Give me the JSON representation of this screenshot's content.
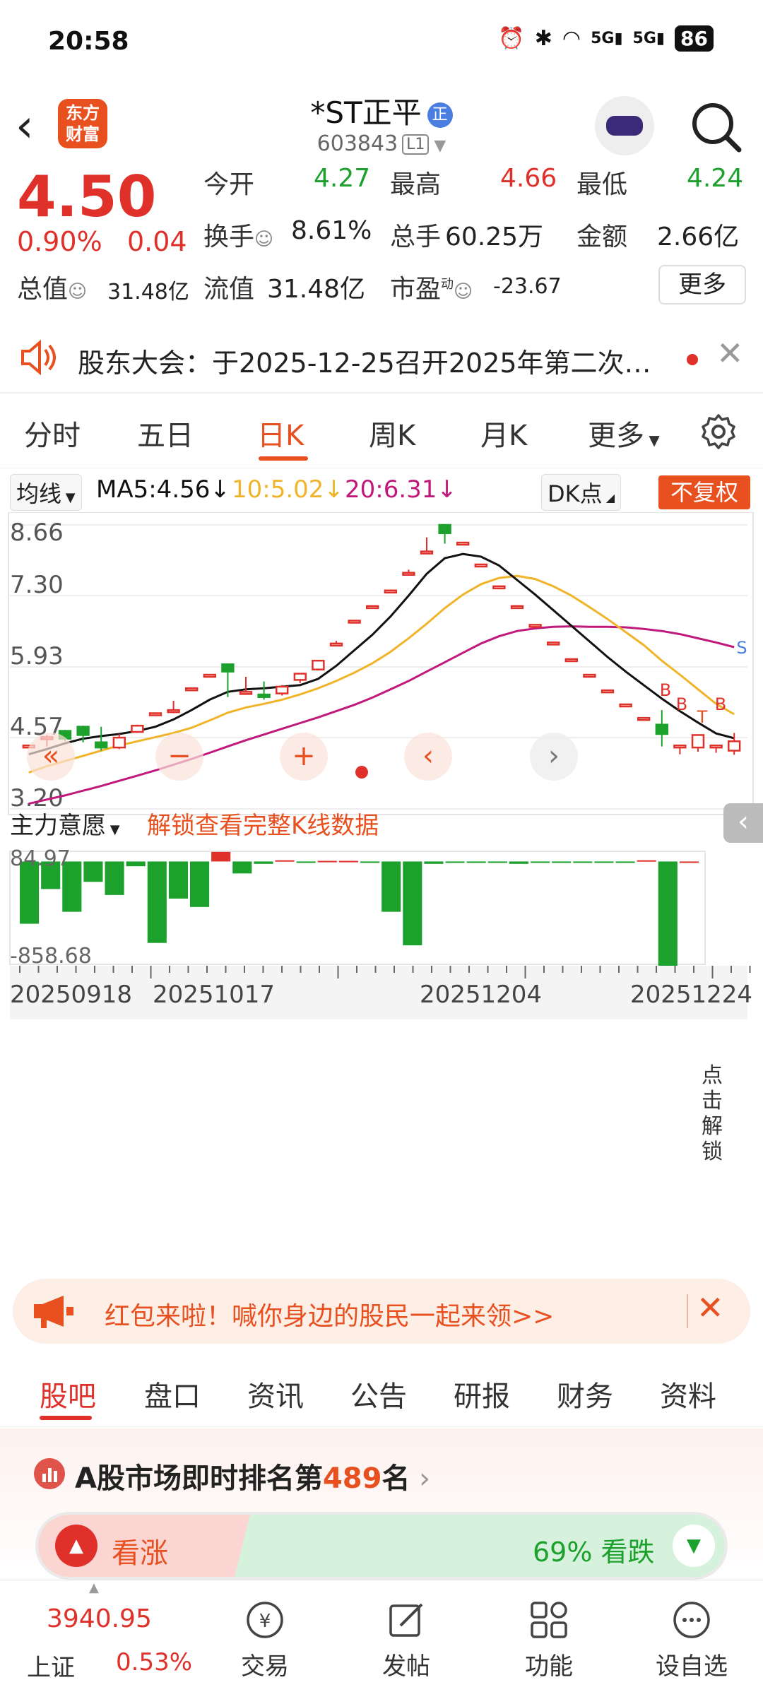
{
  "status_bar": {
    "time": "20:58",
    "battery": "86",
    "signal_1": "5G",
    "signal_2": "5G"
  },
  "header": {
    "logo_line1": "东方",
    "logo_line2": "财富",
    "title": "*ST正平",
    "title_badge": "正",
    "code": "603843",
    "level": "L1"
  },
  "quote": {
    "price": "4.50",
    "change_pct": "0.90%",
    "change_amt": "0.04",
    "open_label": "今开",
    "open": "4.27",
    "high_label": "最高",
    "high": "4.66",
    "low_label": "最低",
    "low": "4.24",
    "turnover_label": "换手",
    "turnover": "8.61%",
    "volume_label": "总手",
    "volume": "60.25万",
    "amount_label": "金额",
    "amount": "2.66亿",
    "total_mv_label": "总值",
    "total_mv": "31.48亿",
    "float_mv_label": "流值",
    "float_mv": "31.48亿",
    "pe_label": "市盈",
    "pe_sup": "动",
    "pe": "-23.67",
    "more": "更多"
  },
  "notice": {
    "text": "股东大会：于2025-12-25召开2025年第二次临..."
  },
  "kline_tabs": {
    "tabs": [
      "分时",
      "五日",
      "日K",
      "周K",
      "月K",
      "更多"
    ],
    "active": "日K"
  },
  "chart_controls": {
    "ma_selector": "均线",
    "ma5": "MA5:4.56",
    "ma10": "10:5.02",
    "ma20": "20:6.31",
    "dk": "DK点",
    "fq": "不复权",
    "indicator_selector": "主力意愿",
    "unlock_text": "解锁查看完整K线数据",
    "click_unlock": "点击解锁"
  },
  "colors": {
    "up": "#e0302a",
    "down": "#1da12d",
    "ma5": "#111111",
    "ma10": "#f0b429",
    "ma20": "#c0197b",
    "accent": "#e8501f"
  },
  "chart_data": {
    "type": "candlestick",
    "y_ticks": [
      "8.66",
      "7.30",
      "5.93",
      "4.57",
      "3.20"
    ],
    "ylim": [
      3.2,
      8.66
    ],
    "x_labels": [
      "20250918",
      "20251017",
      "20251204",
      "20251224"
    ],
    "candles": [
      {
        "o": 4.42,
        "c": 4.42,
        "h": 4.42,
        "l": 4.42
      },
      {
        "o": 4.55,
        "c": 4.58,
        "h": 4.62,
        "l": 4.4
      },
      {
        "o": 4.7,
        "c": 4.55,
        "h": 4.72,
        "l": 4.5
      },
      {
        "o": 4.78,
        "c": 4.62,
        "h": 4.8,
        "l": 4.48
      },
      {
        "o": 4.48,
        "c": 4.38,
        "h": 4.78,
        "l": 4.32
      },
      {
        "o": 4.38,
        "c": 4.57,
        "h": 4.64,
        "l": 4.35
      },
      {
        "o": 4.68,
        "c": 4.8,
        "h": 4.82,
        "l": 4.66
      },
      {
        "o": 5.04,
        "c": 5.04,
        "h": 5.04,
        "l": 5.04
      },
      {
        "o": 5.1,
        "c": 5.1,
        "h": 5.28,
        "l": 5.04
      },
      {
        "o": 5.52,
        "c": 5.52,
        "h": 5.52,
        "l": 5.52
      },
      {
        "o": 5.78,
        "c": 5.78,
        "h": 5.78,
        "l": 5.78
      },
      {
        "o": 5.98,
        "c": 5.84,
        "h": 5.98,
        "l": 5.35
      },
      {
        "o": 5.45,
        "c": 5.45,
        "h": 5.74,
        "l": 5.42
      },
      {
        "o": 5.4,
        "c": 5.35,
        "h": 5.65,
        "l": 5.3
      },
      {
        "o": 5.42,
        "c": 5.55,
        "h": 5.58,
        "l": 5.38
      },
      {
        "o": 5.68,
        "c": 5.8,
        "h": 5.8,
        "l": 5.62
      },
      {
        "o": 5.88,
        "c": 6.05,
        "h": 6.05,
        "l": 5.86
      },
      {
        "o": 6.38,
        "c": 6.38,
        "h": 6.43,
        "l": 6.36
      },
      {
        "o": 6.82,
        "c": 6.82,
        "h": 6.82,
        "l": 6.82
      },
      {
        "o": 7.1,
        "c": 7.1,
        "h": 7.1,
        "l": 7.1
      },
      {
        "o": 7.4,
        "c": 7.4,
        "h": 7.4,
        "l": 7.4
      },
      {
        "o": 7.74,
        "c": 7.74,
        "h": 7.8,
        "l": 7.72
      },
      {
        "o": 8.15,
        "c": 8.15,
        "h": 8.42,
        "l": 8.1
      },
      {
        "o": 8.66,
        "c": 8.5,
        "h": 8.66,
        "l": 8.3
      },
      {
        "o": 8.32,
        "c": 8.32,
        "h": 8.32,
        "l": 8.32
      },
      {
        "o": 7.9,
        "c": 7.9,
        "h": 7.9,
        "l": 7.9
      },
      {
        "o": 7.48,
        "c": 7.48,
        "h": 7.48,
        "l": 7.48
      },
      {
        "o": 7.1,
        "c": 7.1,
        "h": 7.1,
        "l": 7.1
      },
      {
        "o": 6.74,
        "c": 6.74,
        "h": 6.74,
        "l": 6.74
      },
      {
        "o": 6.4,
        "c": 6.4,
        "h": 6.4,
        "l": 6.4
      },
      {
        "o": 6.08,
        "c": 6.08,
        "h": 6.08,
        "l": 6.08
      },
      {
        "o": 5.78,
        "c": 5.78,
        "h": 5.78,
        "l": 5.78
      },
      {
        "o": 5.48,
        "c": 5.48,
        "h": 5.48,
        "l": 5.48
      },
      {
        "o": 5.21,
        "c": 5.21,
        "h": 5.21,
        "l": 5.21
      },
      {
        "o": 4.95,
        "c": 4.95,
        "h": 4.95,
        "l": 4.95
      },
      {
        "o": 4.82,
        "c": 4.64,
        "h": 5.1,
        "l": 4.4
      },
      {
        "o": 4.42,
        "c": 4.42,
        "h": 4.42,
        "l": 4.25
      },
      {
        "o": 4.38,
        "c": 4.62,
        "h": 4.62,
        "l": 4.3
      },
      {
        "o": 4.42,
        "c": 4.42,
        "h": 4.42,
        "l": 4.28
      },
      {
        "o": 4.32,
        "c": 4.5,
        "h": 4.66,
        "l": 4.24
      }
    ],
    "ma5": [
      4.25,
      4.35,
      4.46,
      4.55,
      4.6,
      4.64,
      4.7,
      4.78,
      4.92,
      5.1,
      5.3,
      5.45,
      5.5,
      5.52,
      5.55,
      5.58,
      5.7,
      5.95,
      6.25,
      6.55,
      6.9,
      7.3,
      7.72,
      8.02,
      8.1,
      8.05,
      7.88,
      7.6,
      7.32,
      7.02,
      6.72,
      6.42,
      6.12,
      5.84,
      5.58,
      5.32,
      5.08,
      4.86,
      4.65,
      4.56
    ],
    "ma10": [
      3.9,
      4.02,
      4.12,
      4.22,
      4.32,
      4.42,
      4.5,
      4.58,
      4.66,
      4.76,
      4.9,
      5.05,
      5.15,
      5.22,
      5.3,
      5.4,
      5.52,
      5.66,
      5.82,
      6.0,
      6.22,
      6.48,
      6.76,
      7.06,
      7.32,
      7.52,
      7.64,
      7.68,
      7.62,
      7.48,
      7.3,
      7.08,
      6.85,
      6.6,
      6.35,
      6.05,
      5.78,
      5.5,
      5.22,
      5.02
    ],
    "ma20": [
      3.3,
      3.38,
      3.46,
      3.55,
      3.64,
      3.74,
      3.84,
      3.94,
      4.05,
      4.16,
      4.28,
      4.4,
      4.52,
      4.63,
      4.74,
      4.85,
      4.96,
      5.08,
      5.2,
      5.34,
      5.5,
      5.66,
      5.84,
      6.02,
      6.2,
      6.38,
      6.52,
      6.62,
      6.67,
      6.7,
      6.71,
      6.7,
      6.7,
      6.69,
      6.66,
      6.62,
      6.56,
      6.48,
      6.4,
      6.31
    ],
    "indicator": {
      "name": "主力意愿",
      "y_ticks": [
        "84.97",
        "-858.68"
      ],
      "ylim": [
        -858.68,
        84.97
      ],
      "values": [
        -520,
        -230,
        -420,
        -170,
        -280,
        -40,
        -680,
        -310,
        -380,
        80,
        -100,
        -20,
        10,
        -10,
        5,
        5,
        -5,
        -420,
        -700,
        -20,
        -10,
        -5,
        -10,
        -20,
        -5,
        -5,
        -5,
        -10,
        -10,
        10,
        -900,
        0
      ]
    }
  },
  "banner": {
    "text": "红包来啦！喊你身边的股民一起来领>>"
  },
  "bottom_tabs": {
    "tabs": [
      "股吧",
      "盘口",
      "资讯",
      "公告",
      "研报",
      "财务",
      "资料"
    ],
    "active": "股吧"
  },
  "rank": {
    "text_prefix": "A股市场即时排名第",
    "rank": "489",
    "text_suffix": "名"
  },
  "vote": {
    "up_label": "看涨",
    "down_label": "69% 看跌"
  },
  "bottom_nav": {
    "index_value": "3940.95",
    "index_name": "上证",
    "index_change": "0.53%",
    "items": [
      "交易",
      "发帖",
      "功能",
      "设自选"
    ]
  }
}
